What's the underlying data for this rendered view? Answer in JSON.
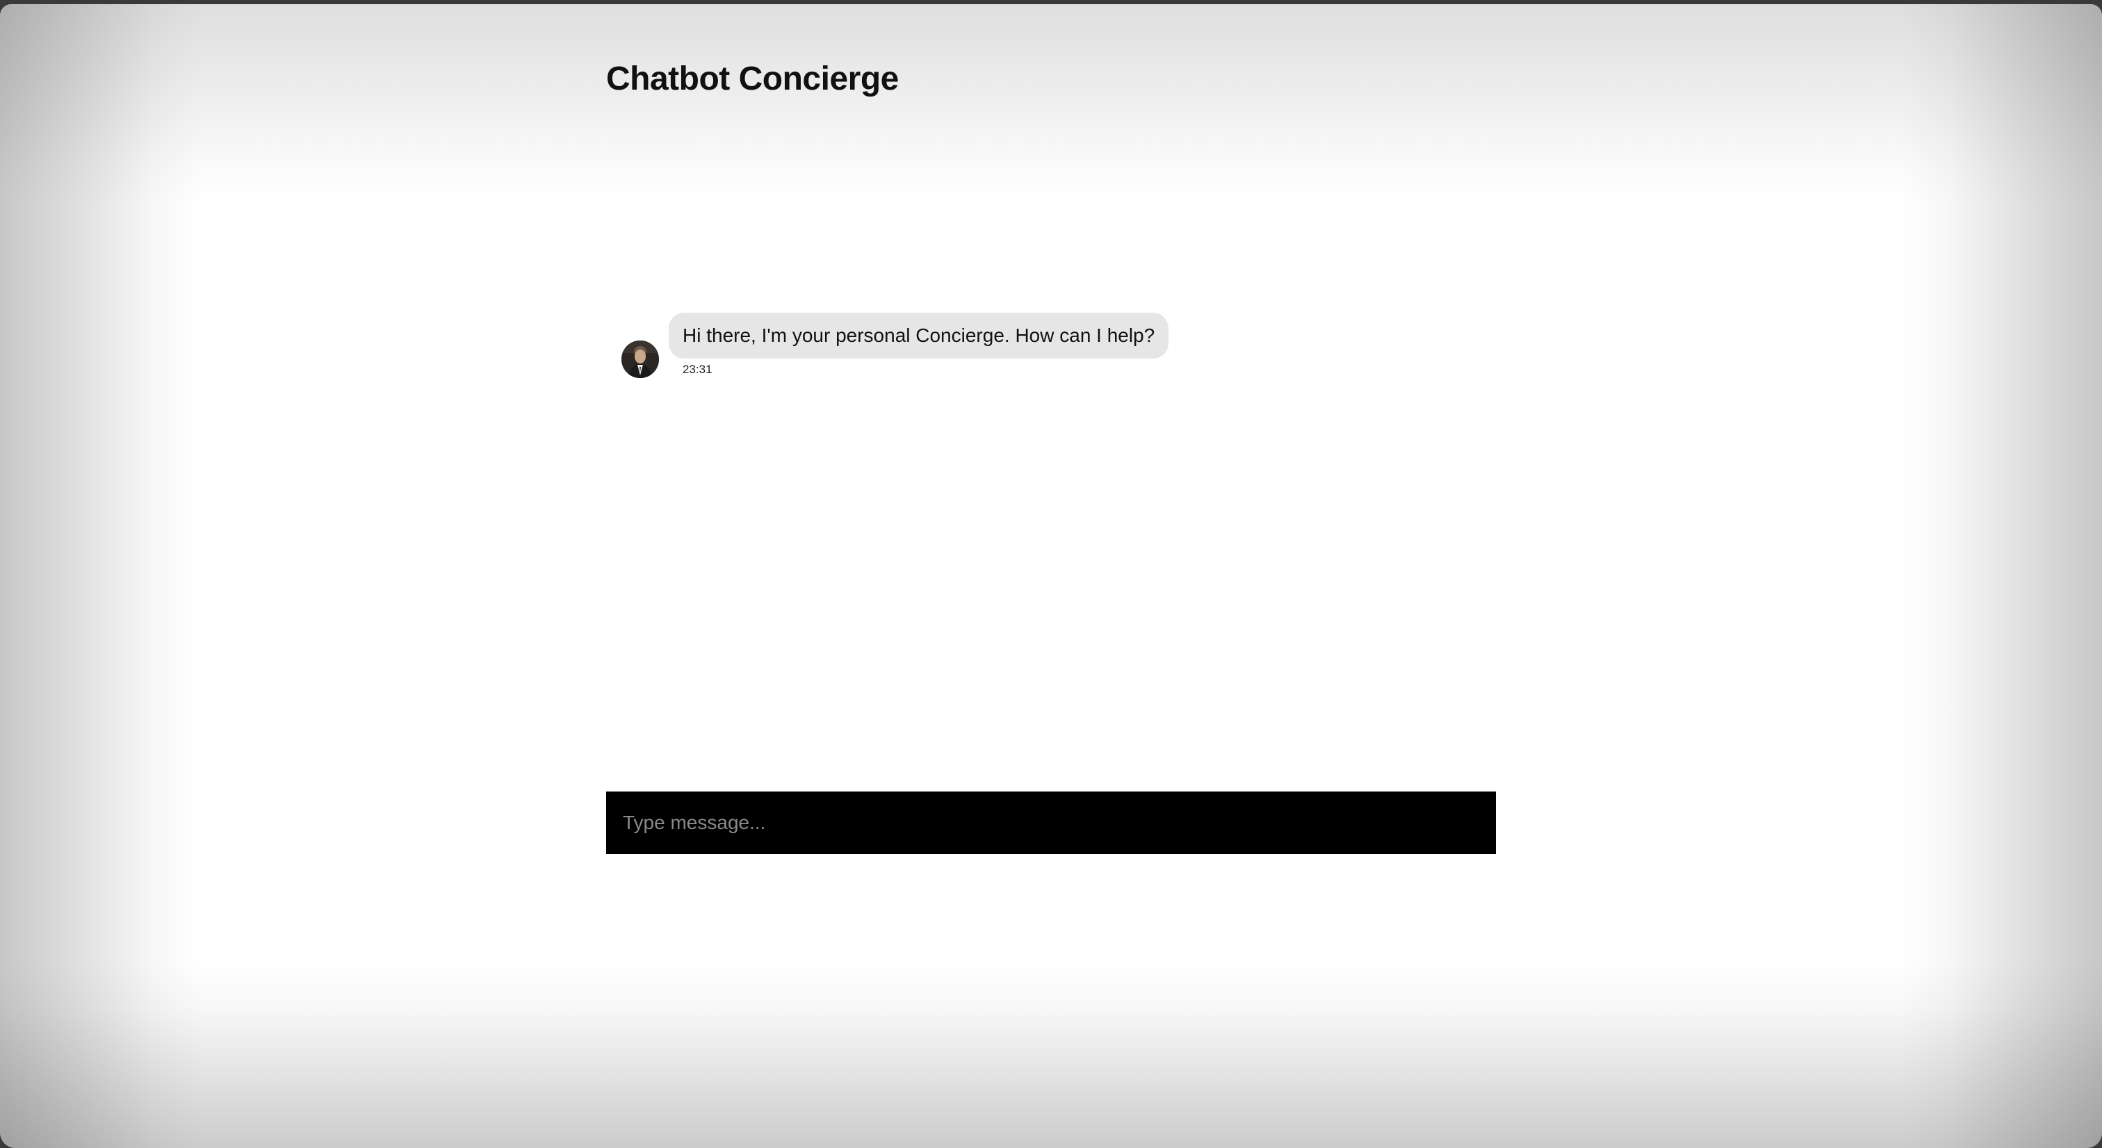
{
  "page": {
    "title": "Chatbot Concierge"
  },
  "chat": {
    "messages": [
      {
        "sender": "bot",
        "avatar_icon": "concierge-avatar",
        "text": "Hi there, I'm your personal Concierge. How can I help?",
        "time": "23:31"
      }
    ]
  },
  "composer": {
    "placeholder": "Type message...",
    "value": ""
  },
  "colors": {
    "bubble_background": "#e6e6e6",
    "composer_background": "#000000",
    "placeholder_text": "#8a8a8a",
    "page_background": "#ffffff"
  }
}
